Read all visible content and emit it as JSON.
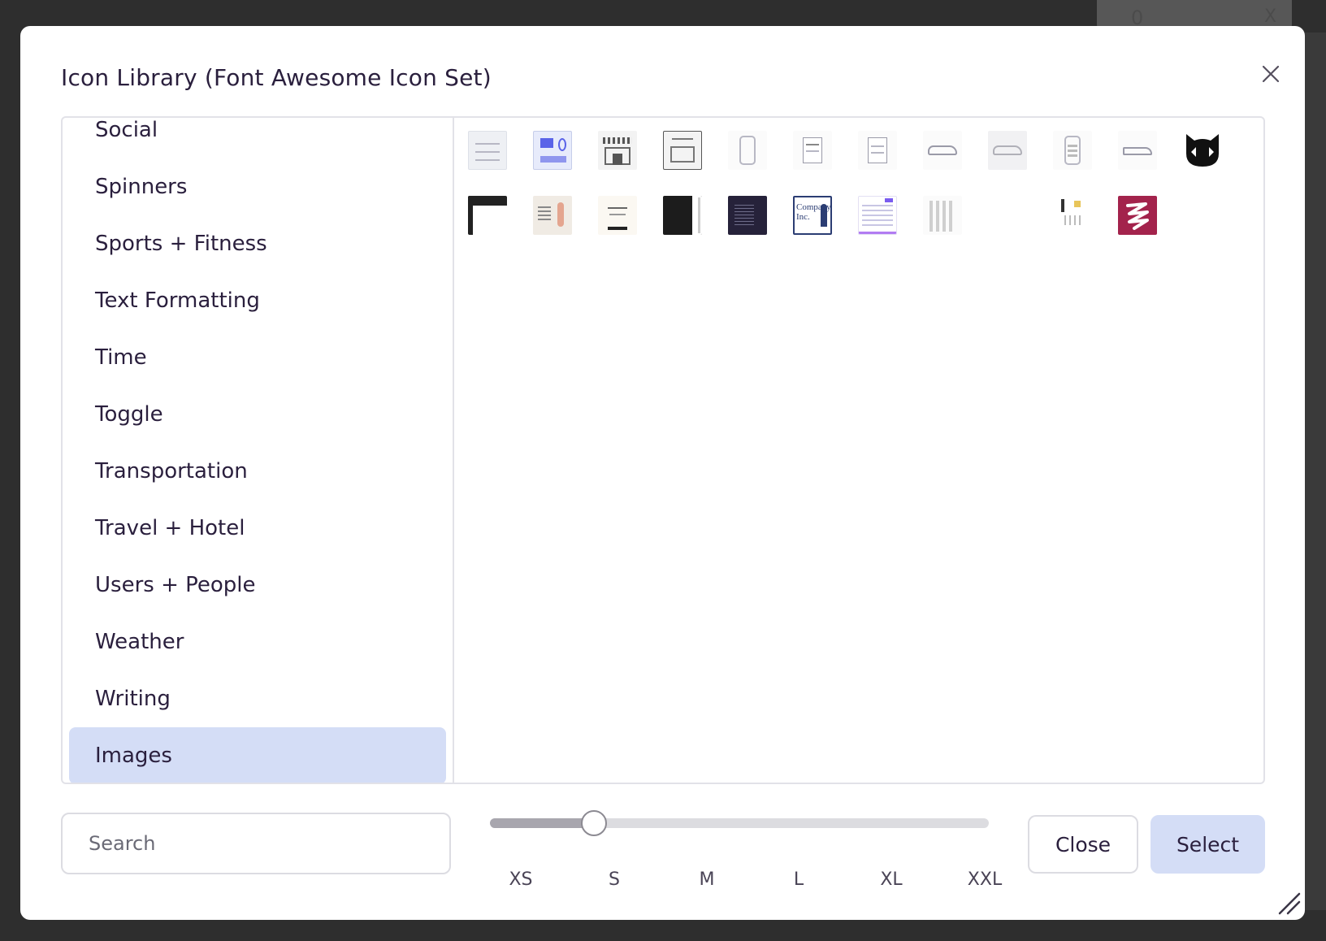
{
  "background": {
    "field_value": "0",
    "field_clear": "X"
  },
  "modal": {
    "title": "Icon Library (Font Awesome Icon Set)",
    "close_icon": "close-icon"
  },
  "categories": [
    {
      "label": "Social",
      "active": false
    },
    {
      "label": "Spinners",
      "active": false
    },
    {
      "label": "Sports + Fitness",
      "active": false
    },
    {
      "label": "Text Formatting",
      "active": false
    },
    {
      "label": "Time",
      "active": false
    },
    {
      "label": "Toggle",
      "active": false
    },
    {
      "label": "Transportation",
      "active": false
    },
    {
      "label": "Travel + Hotel",
      "active": false
    },
    {
      "label": "Users + People",
      "active": false
    },
    {
      "label": "Weather",
      "active": false
    },
    {
      "label": "Writing",
      "active": false
    },
    {
      "label": "Images",
      "active": true
    }
  ],
  "images": {
    "row1": [
      "wireframe-thumbnail",
      "dashboard-thumbnail",
      "storefront-sketch-thumbnail",
      "house-sketch-thumbnail",
      "phone-mockup-thumbnail",
      "document-thumbnail",
      "document-thumbnail",
      "car-sketch-thumbnail",
      "car-photo-thumbnail",
      "phone-grid-thumbnail",
      "car-side-thumbnail",
      "cat-logo-thumbnail"
    ],
    "row2": [
      "dark-editor-thumbnail",
      "photo-collage-thumbnail",
      "text-card-thumbnail",
      "dark-panel-thumbnail",
      "code-screen-thumbnail",
      "company-logo-thumbnail",
      "table-ui-thumbnail",
      "cosmetics-thumbnail",
      "blank-thumbnail",
      "product-collage-thumbnail",
      "brand-logo-thumbnail"
    ]
  },
  "company_thumbnail_text": "Company Inc.",
  "search": {
    "placeholder": "Search",
    "value": ""
  },
  "size_slider": {
    "labels": [
      "XS",
      "S",
      "M",
      "L",
      "XL",
      "XXL"
    ],
    "selected": "S",
    "value_index": 1
  },
  "buttons": {
    "close_label": "Close",
    "select_label": "Select"
  },
  "colors": {
    "accent": "#d4ddf6",
    "text": "#2a1f3d",
    "border": "#e2e2e8",
    "backdrop": "#2e2e2e",
    "magenta": "#a3234c"
  }
}
